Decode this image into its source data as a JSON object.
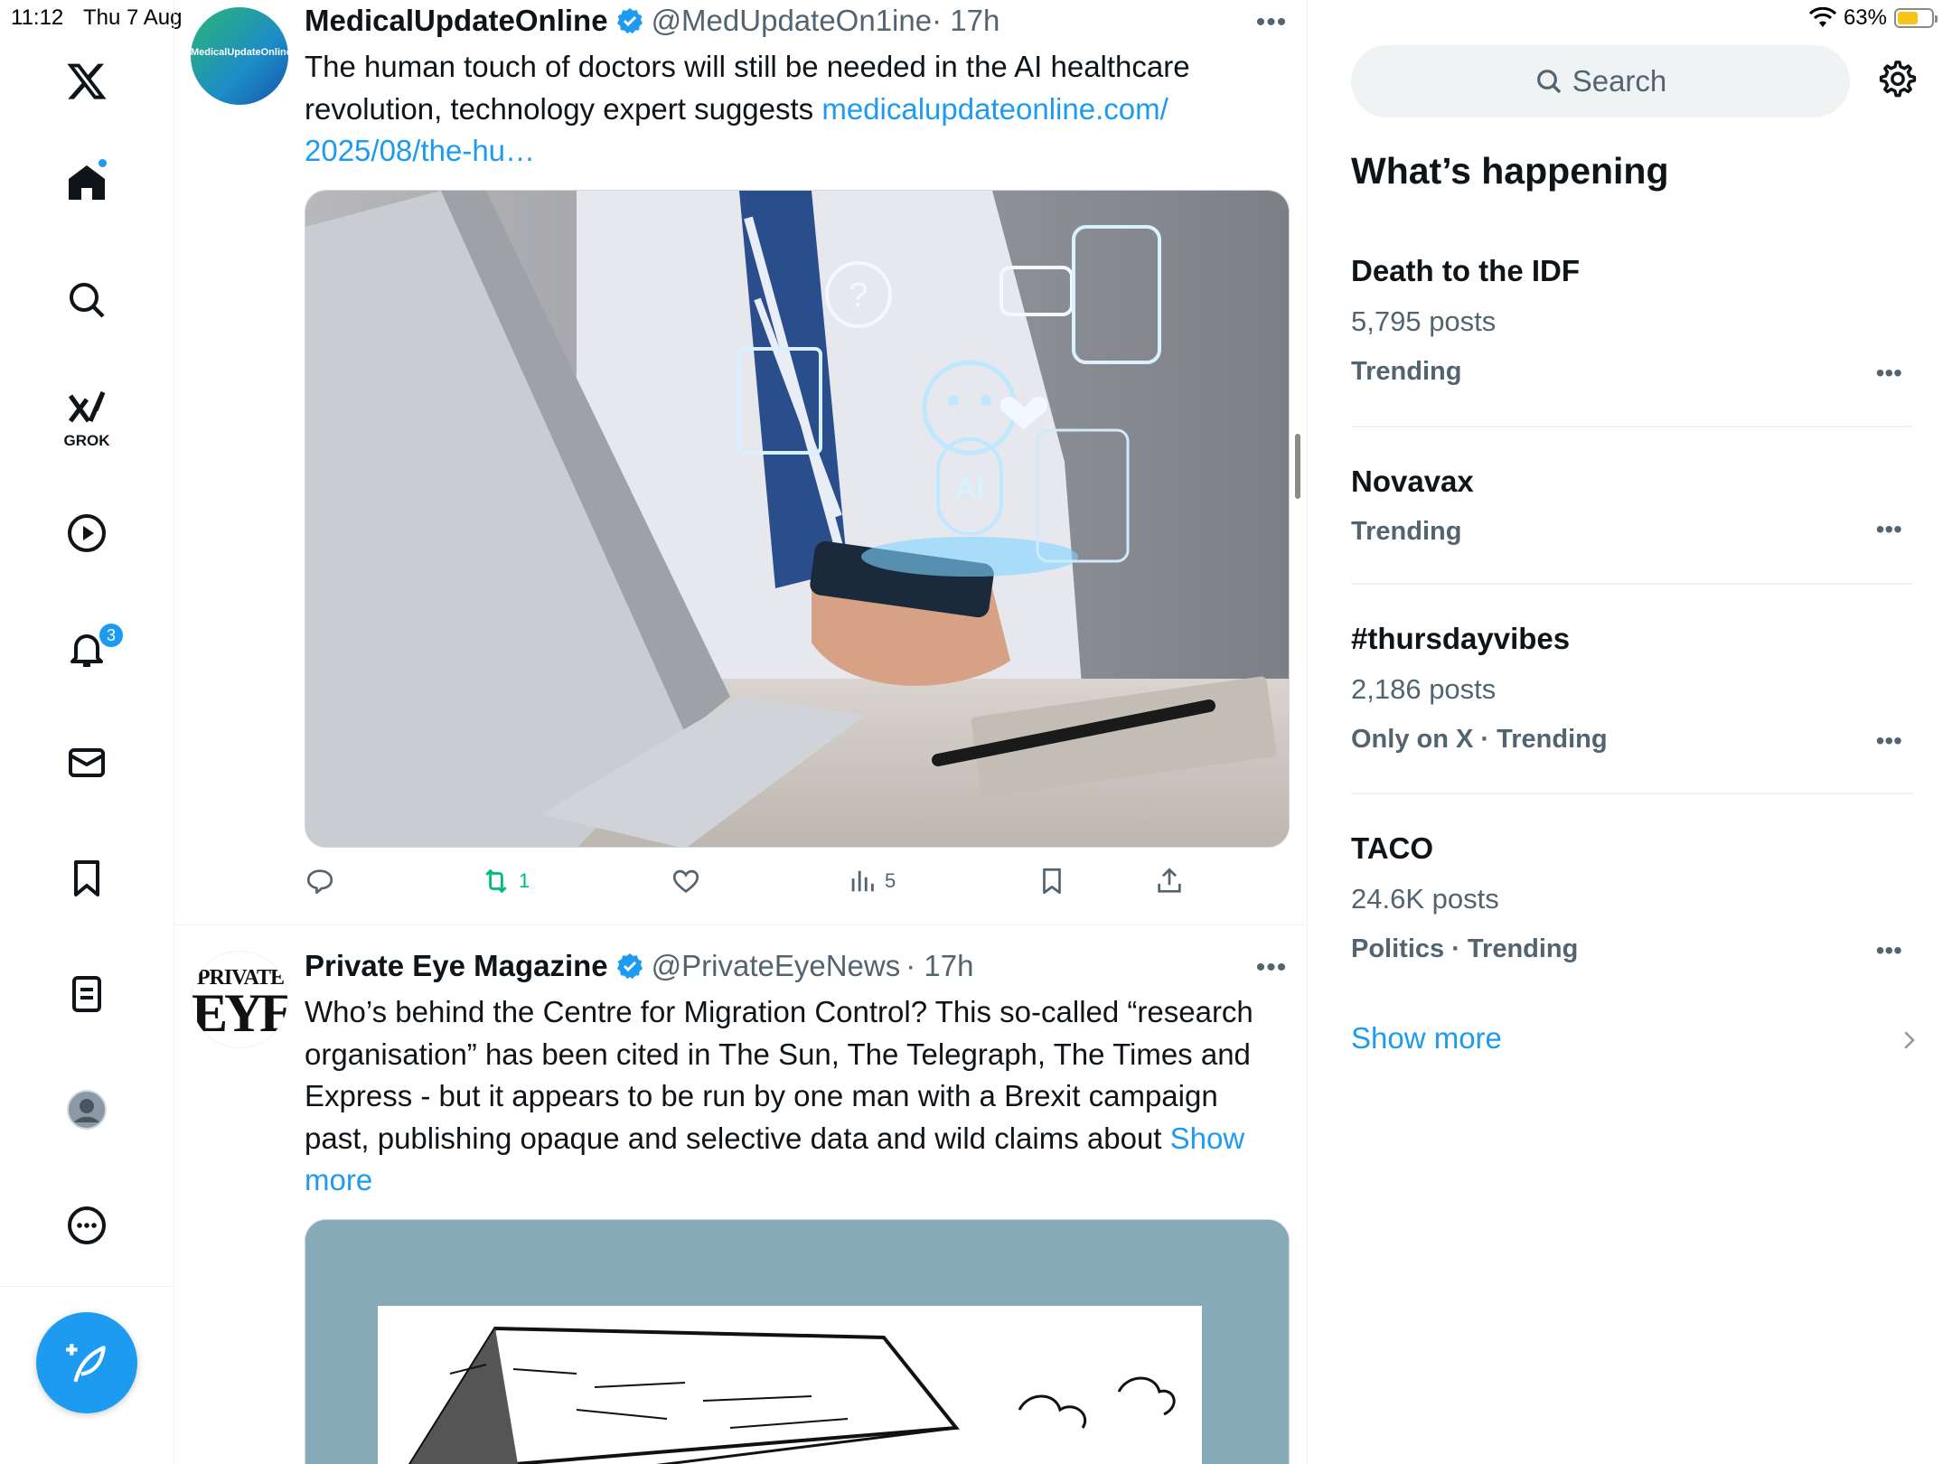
{
  "status": {
    "time": "11:12",
    "date": "Thu 7 Aug",
    "battery": "63%"
  },
  "nav": {
    "grok_label": "GROK",
    "notifications_badge": "3",
    "items": [
      "x-logo",
      "home-icon",
      "search-icon",
      "grok-icon",
      "video-icon",
      "bell-icon",
      "mail-icon",
      "bookmark-icon",
      "lists-icon",
      "profile-icon",
      "more-icon"
    ]
  },
  "tweets": [
    {
      "name": "MedicalUpdateOnline",
      "handle": "@MedUpdateOn1ine",
      "time": "· 17h",
      "text": "The human touch of doctors will still be needed in the AI healthcare revolution, technology expert suggests ",
      "link": "medicalupdateonline.com/ 2025/08/the-hu…",
      "avatar_text": "MedicalUpdateOnline",
      "media_text": "AI",
      "actions": {
        "replies": "",
        "retweets": "1",
        "likes": "",
        "views": "5"
      }
    },
    {
      "name": "Private Eye Magazine",
      "handle": "@PrivateEyeNews",
      "time": "· 17h",
      "text": "Who’s behind the Centre for Migration Control? This so-called “research organisation” has been cited in The Sun, The Telegraph, The Times and Express - but it appears to be run by one man with a Brexit campaign past, publishing opaque and selective data and wild claims about ",
      "link": "Show more",
      "avatar_text_top": "PRIVATE",
      "avatar_text_bottom": "EYE"
    }
  ],
  "right": {
    "search_placeholder": "Search",
    "title": "What’s happening",
    "trends": [
      {
        "topic": "Death to the IDF",
        "posts": "5,795 posts",
        "meta": "Trending"
      },
      {
        "topic": "Novavax",
        "posts": "",
        "meta": "Trending"
      },
      {
        "topic": "#thursdayvibes",
        "posts": "2,186 posts",
        "meta": "Only on X · Trending"
      },
      {
        "topic": "TACO",
        "posts": "24.6K posts",
        "meta": "Politics · Trending"
      }
    ],
    "show_more": "Show more",
    "more_glyph": "•••"
  },
  "colors": {
    "accent": "#1d9bf0",
    "retweet_green": "#00ba7c",
    "muted": "#536471"
  }
}
